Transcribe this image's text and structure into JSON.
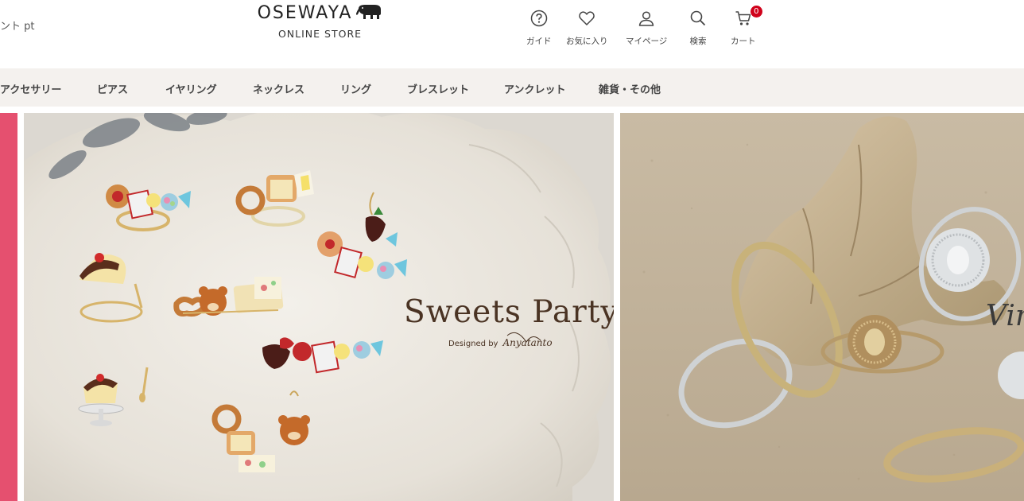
{
  "header": {
    "points_text": "ント pt",
    "logo_text": "OSEWAYA",
    "logo_sub": "ONLINE STORE",
    "utilities": [
      {
        "label": "ガイド",
        "icon": "question-circle-icon"
      },
      {
        "label": "お気に入り",
        "icon": "heart-icon"
      },
      {
        "label": "マイページ",
        "icon": "person-icon"
      },
      {
        "label": "検索",
        "icon": "search-icon"
      },
      {
        "label": "カート",
        "icon": "cart-icon",
        "badge": "0"
      }
    ]
  },
  "nav": {
    "items": [
      "アクセサリー",
      "ピアス",
      "イヤリング",
      "ネックレス",
      "リング",
      "ブレスレット",
      "アンクレット",
      "雑貨・その他"
    ]
  },
  "banners": {
    "main_title": "Sweets Party",
    "main_designed_by": "Designed by",
    "main_designer": "Anyatanto",
    "right_text": "Vin"
  },
  "colors": {
    "accent_pink": "#e5506f",
    "nav_bg": "#f4f1ee",
    "badge_red": "#d0021b",
    "title_brown": "#4a3323"
  }
}
